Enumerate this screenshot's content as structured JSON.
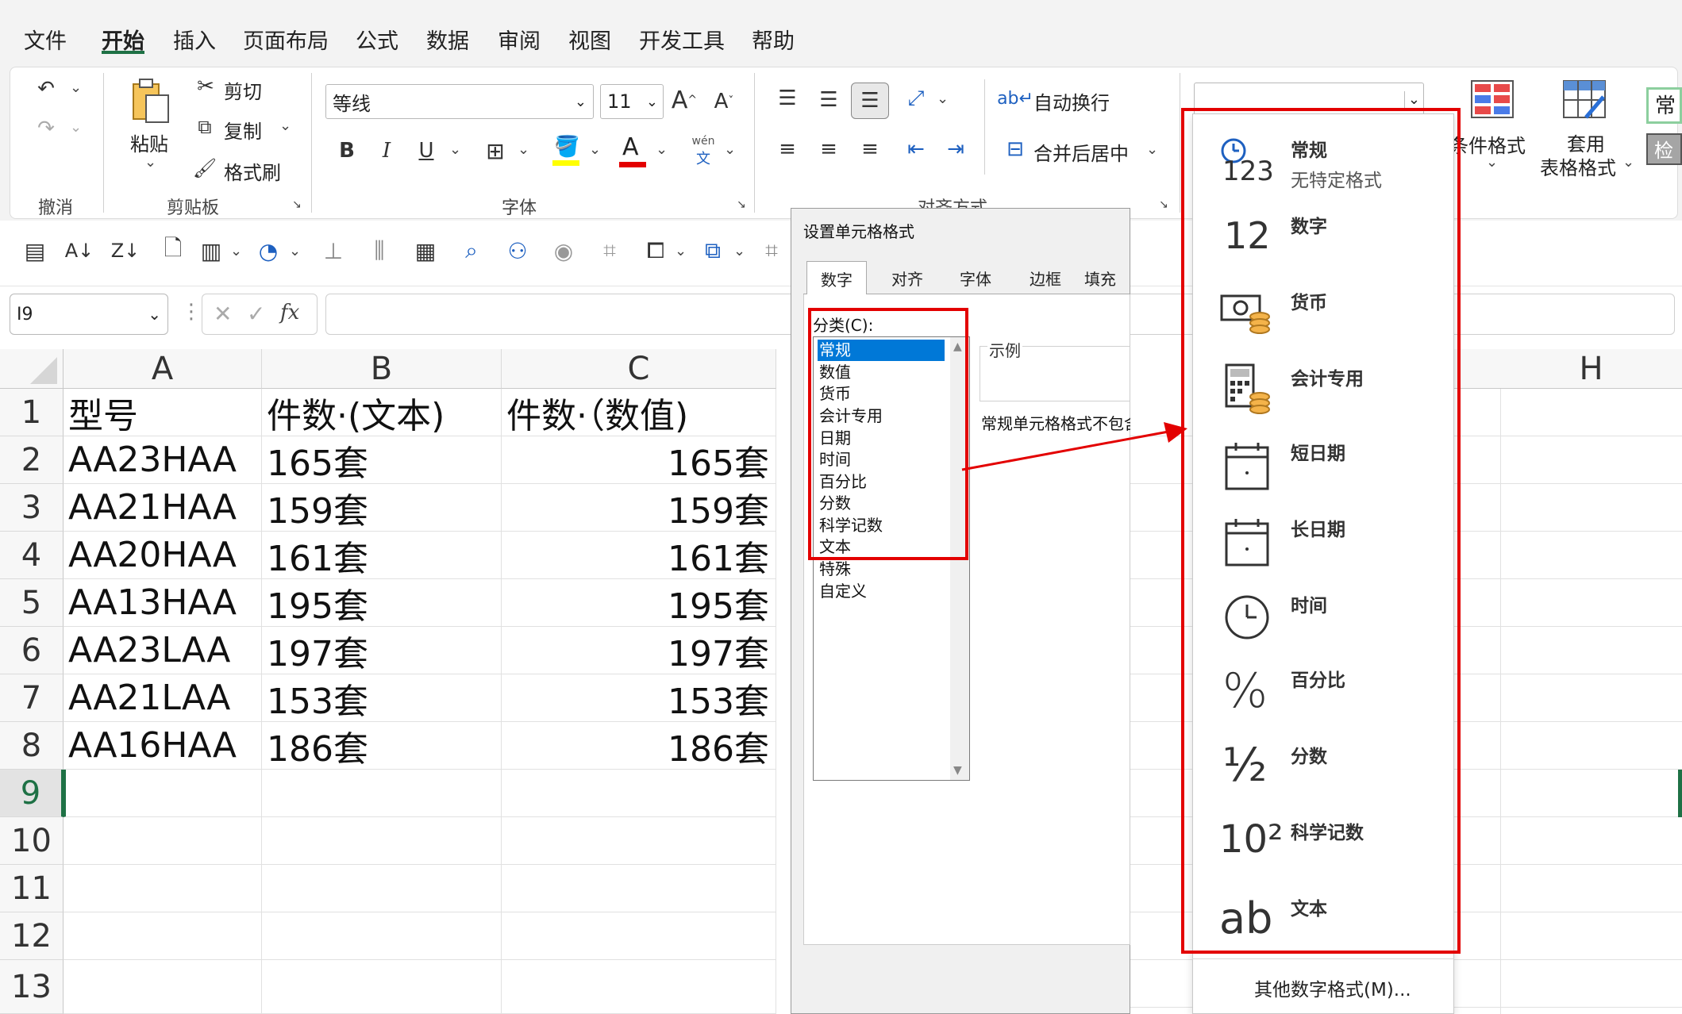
{
  "menu": [
    "文件",
    "开始",
    "插入",
    "页面布局",
    "公式",
    "数据",
    "审阅",
    "视图",
    "开发工具",
    "帮助"
  ],
  "ribbon": {
    "undo_group": "撤消",
    "paste": "粘贴",
    "cut": "剪切",
    "copy": "复制",
    "format_painter": "格式刷",
    "clipboard_group": "剪贴板",
    "font_name": "等线",
    "font_size": "11",
    "bold": "B",
    "italic": "I",
    "underline": "U",
    "font_color_glyph": "A",
    "phonetic_top": "wén",
    "phonetic_bottom": "文",
    "font_group": "字体",
    "wrap_text": "自动换行",
    "merge_center": "合并后居中",
    "align_group": "对齐方式",
    "conditional_format": "条件格式",
    "table_format_1": "套用",
    "table_format_2": "表格格式",
    "style_1": "常",
    "style_2": "检",
    "number_format_value": ""
  },
  "formula_bar": {
    "name_box": "I9",
    "fx": "fx"
  },
  "columns": [
    "A",
    "B",
    "C",
    "H"
  ],
  "rows": [
    "1",
    "2",
    "3",
    "4",
    "5",
    "6",
    "7",
    "8",
    "9",
    "10",
    "11",
    "12",
    "13"
  ],
  "table": {
    "headers": [
      "型号",
      "件数·(文本)",
      "件数·（数值)"
    ],
    "data": [
      [
        "AA23HAA",
        "165套",
        "165套"
      ],
      [
        "AA21HAA",
        "159套",
        "159套"
      ],
      [
        "AA20HAA",
        "161套",
        "161套"
      ],
      [
        "AA13HAA",
        "195套",
        "195套"
      ],
      [
        "AA23LAA",
        "197套",
        "197套"
      ],
      [
        "AA21LAA",
        "153套",
        "153套"
      ],
      [
        "AA16HAA",
        "186套",
        "186套"
      ]
    ]
  },
  "dialog": {
    "title": "设置单元格格式",
    "tabs": [
      "数字",
      "对齐",
      "字体",
      "边框",
      "填充"
    ],
    "category_label": "分类(C):",
    "categories": [
      "常规",
      "数值",
      "货币",
      "会计专用",
      "日期",
      "时间",
      "百分比",
      "分数",
      "科学记数",
      "文本",
      "特殊",
      "自定义"
    ],
    "sample_label": "示例",
    "description": "常规单元格格式不包含"
  },
  "dropdown": {
    "items": [
      {
        "label": "常规",
        "sub": "无特定格式",
        "icon": "general-123-icon",
        "glyph": "123"
      },
      {
        "label": "数字",
        "icon": "number-12-icon",
        "glyph": "12"
      },
      {
        "label": "货币",
        "icon": "currency-icon",
        "glyph": ""
      },
      {
        "label": "会计专用",
        "icon": "accounting-calculator-icon",
        "glyph": ""
      },
      {
        "label": "短日期",
        "icon": "short-date-calendar-icon",
        "glyph": ""
      },
      {
        "label": "长日期",
        "icon": "long-date-calendar-icon",
        "glyph": ""
      },
      {
        "label": "时间",
        "icon": "clock-icon",
        "glyph": ""
      },
      {
        "label": "百分比",
        "icon": "percent-icon",
        "glyph": "%"
      },
      {
        "label": "分数",
        "icon": "fraction-icon",
        "glyph": "½"
      },
      {
        "label": "科学记数",
        "icon": "scientific-icon",
        "glyph": "10²"
      },
      {
        "label": "文本",
        "icon": "text-ab-icon",
        "glyph": "ab"
      }
    ],
    "more": "其他数字格式(M)..."
  },
  "colors": {
    "accent_green": "#1e7145",
    "highlight_red": "#e30000",
    "selection_blue": "#0078d7"
  }
}
